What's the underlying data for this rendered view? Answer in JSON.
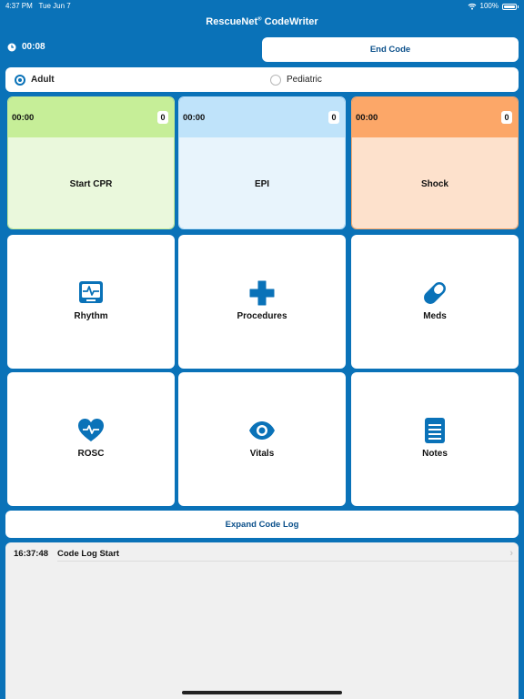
{
  "status_bar": {
    "time": "4:37 PM",
    "date": "Tue Jun 7",
    "battery": "100%"
  },
  "app": {
    "title": "RescueNet",
    "trademark": "®",
    "title_suffix": " CodeWriter"
  },
  "header": {
    "elapsed": "00:08",
    "end_code_label": "End Code"
  },
  "patient_type": {
    "options": [
      "Adult",
      "Pediatric"
    ],
    "selected": "Adult"
  },
  "timer_tiles": [
    {
      "label": "Start CPR",
      "time": "00:00",
      "count": "0",
      "top_color": "#c6ee98",
      "bottom_color": "#eaf8dc"
    },
    {
      "label": "EPI",
      "time": "00:00",
      "count": "0",
      "top_color": "#bfe3fa",
      "bottom_color": "#e8f4fc"
    },
    {
      "label": "Shock",
      "time": "00:00",
      "count": "0",
      "top_color": "#fca768",
      "bottom_color": "#fde1cc"
    }
  ],
  "menu_tiles": [
    {
      "label": "Rhythm",
      "icon": "monitor-ecg-icon"
    },
    {
      "label": "Procedures",
      "icon": "plus-icon"
    },
    {
      "label": "Meds",
      "icon": "pill-icon"
    },
    {
      "label": "ROSC",
      "icon": "heart-pulse-icon"
    },
    {
      "label": "Vitals",
      "icon": "eye-icon"
    },
    {
      "label": "Notes",
      "icon": "notes-icon"
    }
  ],
  "expand_log_label": "Expand Code Log",
  "code_log": [
    {
      "time": "16:37:48",
      "text": "Code Log Start"
    }
  ],
  "colors": {
    "accent": "#0a72b8",
    "button_text": "#0a4f8a",
    "panel": "#f0f0f0"
  }
}
